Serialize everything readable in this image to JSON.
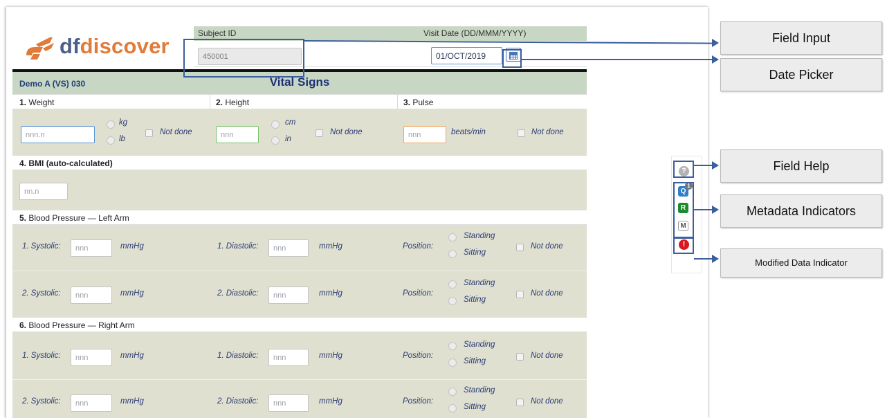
{
  "logo": {
    "prefix": "df",
    "suffix": "discover"
  },
  "header": {
    "subject_id_label": "Subject ID",
    "subject_id_value": "450001",
    "visit_date_label": "Visit Date (DD/MMM/YYYY)",
    "visit_date_value": "01/OCT/2019",
    "calendar_icon": "calendar-icon"
  },
  "form": {
    "code": "Demo A (VS) 030",
    "title": "Vital Signs"
  },
  "q1": {
    "num": "1.",
    "label": "Weight",
    "placeholder": "nnn.n",
    "unit1": "kg",
    "unit2": "lb",
    "not_done": "Not done"
  },
  "q2": {
    "num": "2.",
    "label": "Height",
    "placeholder": "nnn",
    "unit1": "cm",
    "unit2": "in",
    "not_done": "Not done"
  },
  "q3": {
    "num": "3.",
    "label": "Pulse",
    "placeholder": "nnn",
    "unit": "beats/min",
    "not_done": "Not done"
  },
  "q4": {
    "num": "4.",
    "label": "BMI (auto-calculated)",
    "placeholder": "nn.n"
  },
  "q5": {
    "num": "5.",
    "label": "Blood Pressure — Left Arm",
    "rows": [
      {
        "systolic": "1. Systolic:",
        "diastolic": "1. Diastolic:",
        "placeholder": "nnn",
        "unit": "mmHg",
        "position": "Position:",
        "standing": "Standing",
        "sitting": "Sitting",
        "not_done": "Not done"
      },
      {
        "systolic": "2. Systolic:",
        "diastolic": "2. Diastolic:",
        "placeholder": "nnn",
        "unit": "mmHg",
        "position": "Position:",
        "standing": "Standing",
        "sitting": "Sitting",
        "not_done": "Not done"
      }
    ]
  },
  "q6": {
    "num": "6.",
    "label": "Blood Pressure — Right Arm",
    "rows": [
      {
        "systolic": "1. Systolic:",
        "diastolic": "1. Diastolic:",
        "placeholder": "nnn",
        "unit": "mmHg",
        "position": "Position:",
        "standing": "Standing",
        "sitting": "Sitting",
        "not_done": "Not done"
      },
      {
        "systolic": "2. Systolic:",
        "diastolic": "2. Diastolic:",
        "placeholder": "nnn",
        "unit": "mmHg",
        "position": "Position:",
        "standing": "Standing",
        "sitting": "Sitting",
        "not_done": "Not done"
      }
    ]
  },
  "indicators": {
    "help": "?",
    "query": "Q",
    "query_count": "1",
    "reason": "R",
    "missing": "M",
    "modified": "!"
  },
  "callouts": {
    "field_input": "Field Input",
    "date_picker": "Date Picker",
    "field_help": "Field Help",
    "metadata": "Metadata Indicators",
    "modified": "Modified Data Indicator"
  },
  "colors": {
    "header_band": "#c7d7c3",
    "body_band": "#dfe0d0",
    "title_text": "#1f2f75",
    "callout_line": "#3b5e9c",
    "logo_orange": "#e07b39",
    "logo_blue": "#4b5f87"
  }
}
